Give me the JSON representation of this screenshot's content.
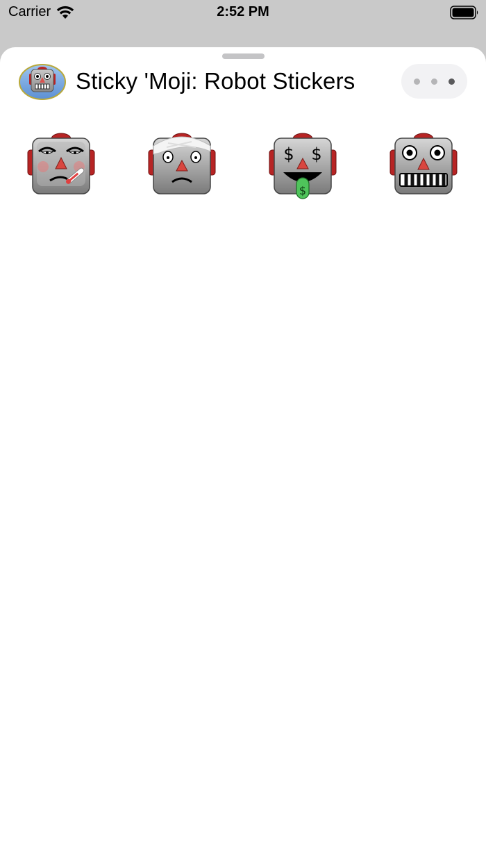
{
  "status_bar": {
    "carrier": "Carrier",
    "time": "2:52 PM"
  },
  "app": {
    "title": "Sticky 'Moji: Robot Stickers",
    "icon": "robot-app-icon"
  },
  "more_menu": {
    "icon": "ellipsis-icon",
    "dots": 3
  },
  "stickers": [
    {
      "name": "sick-robot",
      "face": "thermometer"
    },
    {
      "name": "bandaged-robot",
      "face": "bandage"
    },
    {
      "name": "money-face-robot",
      "face": "dollar-eyes"
    },
    {
      "name": "grinning-robot",
      "face": "grin"
    }
  ],
  "colors": {
    "sheet_background": "#ffffff",
    "backdrop": "#c9c9c9",
    "robot_gray": "#9a9a9a",
    "robot_ears": "#c22a2a",
    "nose": "#d9534f",
    "money_green": "#3ea84b"
  }
}
